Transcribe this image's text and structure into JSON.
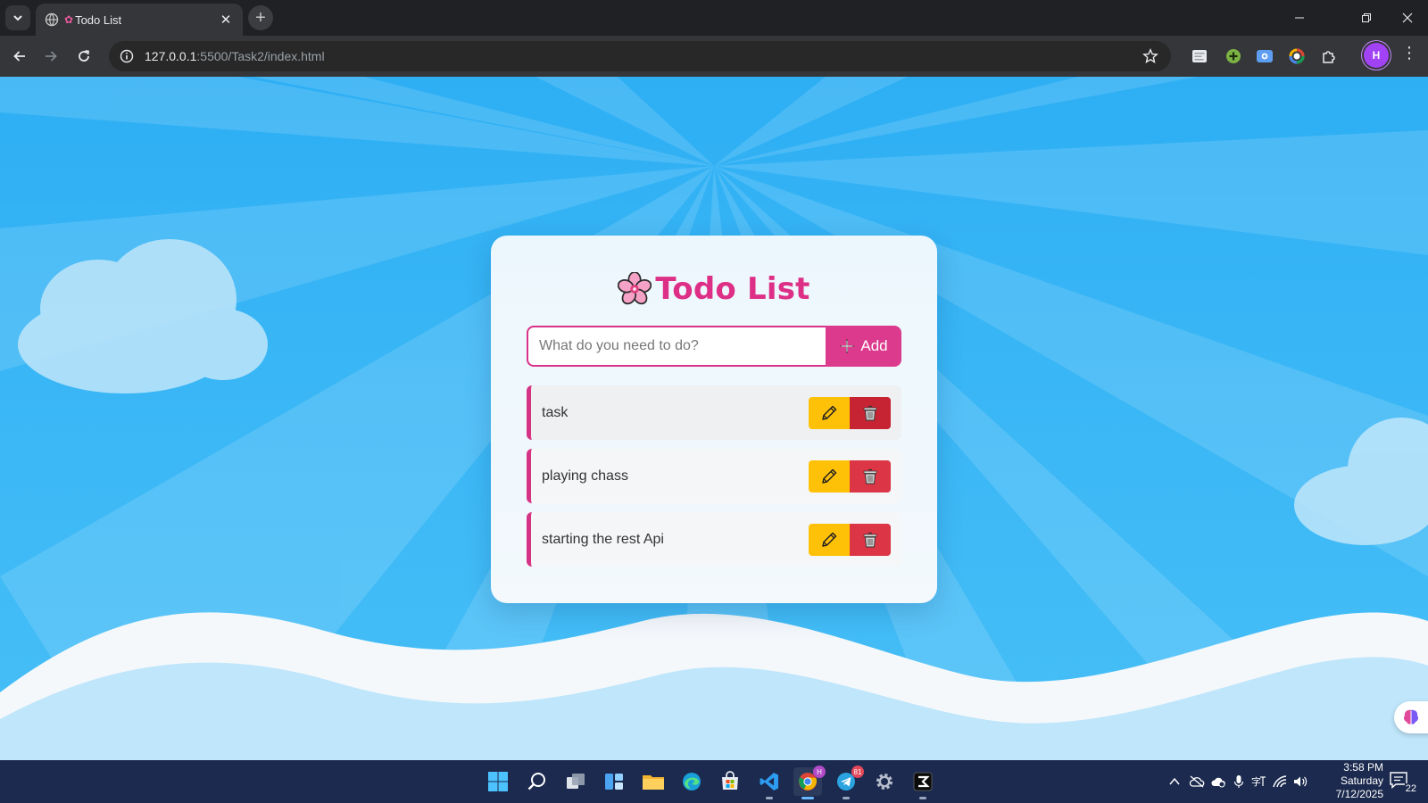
{
  "browser": {
    "tab_title": "Todo List",
    "tab_favicon": "cherry-blossom",
    "url_host": "127.0.0.1",
    "url_path": ":5500/Task2/index.html",
    "profile_initial": "H"
  },
  "app": {
    "title": "Todo List",
    "input_placeholder": "What do you need to do?",
    "input_value": "",
    "add_label": "Add",
    "todos": [
      {
        "text": "task"
      },
      {
        "text": "playing chass"
      },
      {
        "text": "starting the rest Api"
      }
    ],
    "colors": {
      "accent": "#de2f87",
      "edit": "#ffc107",
      "delete": "#dc3545",
      "sky": "#37b4f4"
    }
  },
  "taskbar": {
    "chrome_badge": "H",
    "telegram_badge": "81",
    "time": "3:58 PM",
    "day": "Saturday",
    "date": "7/12/2025",
    "notifications": "22"
  }
}
